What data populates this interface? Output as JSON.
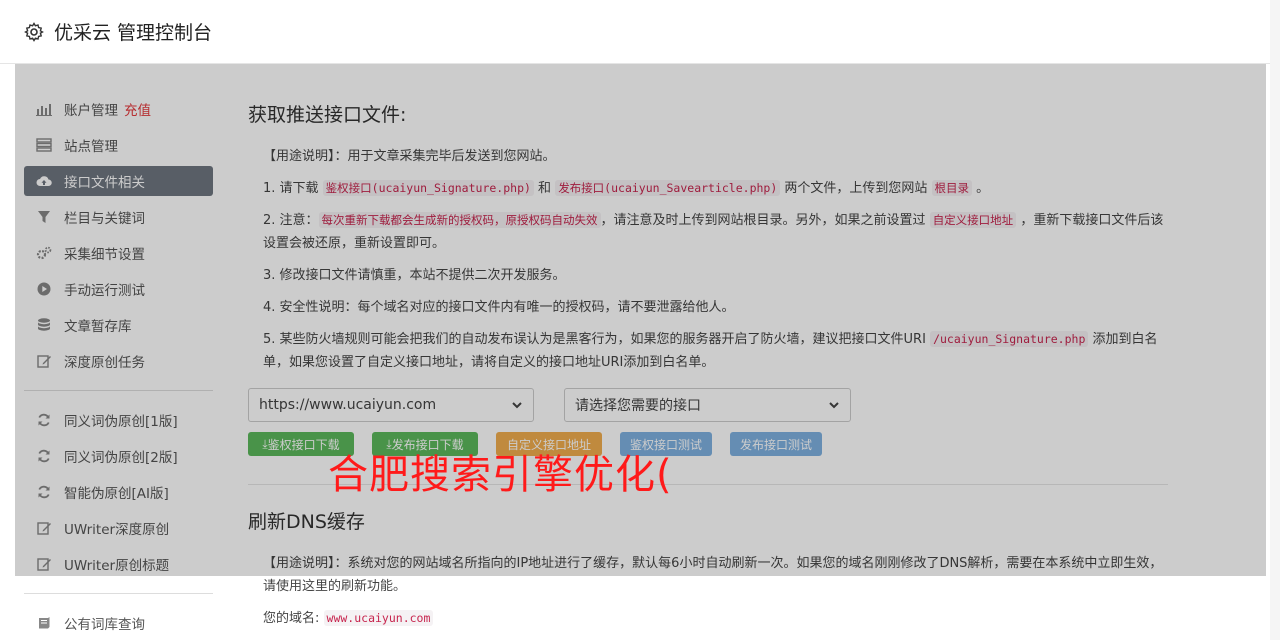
{
  "header": {
    "title": "优采云 管理控制台",
    "icon": "gear-icon"
  },
  "sidebar": {
    "items": [
      {
        "label": "账户管理",
        "extra": "充值",
        "icon": "bar-chart-icon"
      },
      {
        "label": "站点管理",
        "icon": "server-icon"
      },
      {
        "label": "接口文件相关",
        "icon": "cloud-upload-icon",
        "active": true
      },
      {
        "label": "栏目与关键词",
        "icon": "filter-icon"
      },
      {
        "label": "采集细节设置",
        "icon": "cogs-icon"
      },
      {
        "label": "手动运行测试",
        "icon": "play-circle-icon"
      },
      {
        "label": "文章暂存库",
        "icon": "database-icon"
      },
      {
        "label": "深度原创任务",
        "icon": "edit-icon"
      }
    ],
    "items2": [
      {
        "label": "同义词伪原创[1版]",
        "icon": "refresh-icon"
      },
      {
        "label": "同义词伪原创[2版]",
        "icon": "refresh-icon"
      },
      {
        "label": "智能伪原创[AI版]",
        "icon": "refresh-icon"
      },
      {
        "label": "UWriter深度原创",
        "icon": "edit-icon"
      },
      {
        "label": "UWriter原创标题",
        "icon": "edit-icon"
      }
    ],
    "items3": [
      {
        "label": "公有词库查询",
        "icon": "book-icon"
      }
    ]
  },
  "main": {
    "section1_title": "获取推送接口文件:",
    "usage_label": "【用途说明】：用于文章采集完毕后发送到您网站。",
    "p1": {
      "a": "1. 请下载 ",
      "code1": "鉴权接口(ucaiyun_Signature.php)",
      "b": " 和 ",
      "code2": "发布接口(ucaiyun_Savearticle.php)",
      "c": " 两个文件，上传到您网站 ",
      "code3": "根目录",
      "d": " 。"
    },
    "p2": {
      "a": "2. 注意：",
      "code1": "每次重新下载都会生成新的授权码，原授权码自动失效",
      "b": "，请注意及时上传到网站根目录。另外，如果之前设置过 ",
      "code2": "自定义接口地址",
      "c": " ，重新下载接口文件后该设置会被还原，重新设置即可。"
    },
    "p3": "3. 修改接口文件请慎重，本站不提供二次开发服务。",
    "p4": "4. 安全性说明：每个域名对应的接口文件内有唯一的授权码，请不要泄露给他人。",
    "p5": {
      "a": "5. 某些防火墙规则可能会把我们的自动发布误认为是黑客行为，如果您的服务器开启了防火墙，建议把接口文件URI ",
      "code1": "/ucaiyun_Signature.php",
      "b": " 添加到白名单，如果您设置了自定义接口地址，请将自定义的接口地址URI添加到白名单。"
    },
    "select_site": "https://www.ucaiyun.com",
    "select_api": "请选择您需要的接口",
    "btn1": "鉴权接口下载",
    "btn2": "发布接口下载",
    "btn3": "自定义接口地址",
    "btn4": "鉴权接口测试",
    "btn5": "发布接口测试",
    "section2_title": "刷新DNS缓存",
    "dns_usage": "【用途说明】：系统对您的网站域名所指向的IP地址进行了缓存，默认每6小时自动刷新一次。如果您的域名刚刚修改了DNS解析，需要在本系统中立即生效，请使用这里的刷新功能。",
    "domain_label": "您的域名:",
    "domain_value": "www.ucaiyun.com"
  },
  "watermark": "合肥搜索引擎优化("
}
